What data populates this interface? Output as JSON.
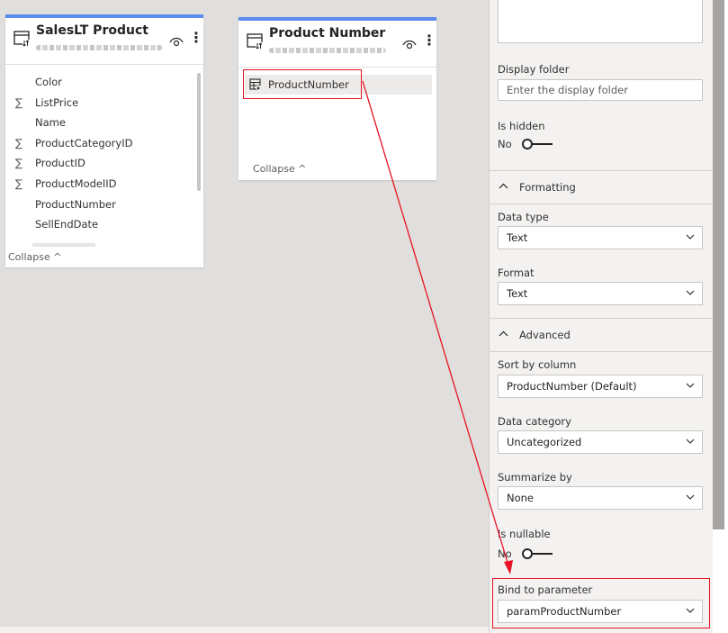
{
  "sales_card": {
    "title": "SalesLT Product",
    "fields": [
      {
        "name": "Color",
        "sigma": ""
      },
      {
        "name": "ListPrice",
        "sigma": "∑"
      },
      {
        "name": "Name",
        "sigma": ""
      },
      {
        "name": "ProductCategoryID",
        "sigma": "∑"
      },
      {
        "name": "ProductID",
        "sigma": "∑"
      },
      {
        "name": "ProductModelID",
        "sigma": "∑"
      },
      {
        "name": "ProductNumber",
        "sigma": ""
      },
      {
        "name": "SellEndDate",
        "sigma": ""
      }
    ],
    "collapse": "Collapse ^"
  },
  "number_card": {
    "title": "Product Number",
    "field": "ProductNumber",
    "collapse": "Collapse ^"
  },
  "properties": {
    "display_folder_label": "Display folder",
    "display_folder_placeholder": "Enter the display folder",
    "is_hidden_label": "Is hidden",
    "is_hidden_value": "No",
    "formatting_header": "Formatting",
    "data_type_label": "Data type",
    "data_type_value": "Text",
    "format_label": "Format",
    "format_value": "Text",
    "advanced_header": "Advanced",
    "sort_by_label": "Sort by column",
    "sort_by_value": "ProductNumber (Default)",
    "data_category_label": "Data category",
    "data_category_value": "Uncategorized",
    "summarize_label": "Summarize by",
    "summarize_value": "None",
    "nullable_label": "Is nullable",
    "nullable_value": "No",
    "bind_label": "Bind to parameter",
    "bind_value": "paramProductNumber"
  },
  "colors": {
    "card_accent": "#5b8def",
    "highlight": "#e81123",
    "panel_bg": "#f3f2f1",
    "canvas_bg": "#e1dfdd"
  }
}
